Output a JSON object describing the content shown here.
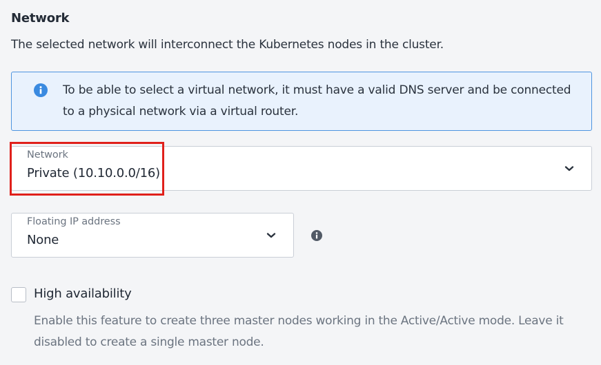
{
  "section": {
    "title": "Network",
    "description": "The selected network will interconnect the Kubernetes nodes in the cluster."
  },
  "info_box": {
    "icon": "info-icon",
    "text": "To be able to select a virtual network, it must have a valid DNS server and be connected to a physical network via a virtual router."
  },
  "network_select": {
    "label": "Network",
    "value": "Private (10.10.0.0/16)",
    "icon": "chevron-down-icon"
  },
  "floating_ip_select": {
    "label": "Floating IP address",
    "value": "None",
    "icon": "chevron-down-icon",
    "help_icon": "info-icon"
  },
  "high_availability": {
    "label": "High availability",
    "checked": false,
    "description": "Enable this feature to create three master nodes working in the Active/Active mode. Leave it disabled to create a single master node."
  },
  "colors": {
    "info_accent": "#3a8ae0",
    "info_background": "#e9f2fd",
    "highlight": "#e0201b"
  }
}
